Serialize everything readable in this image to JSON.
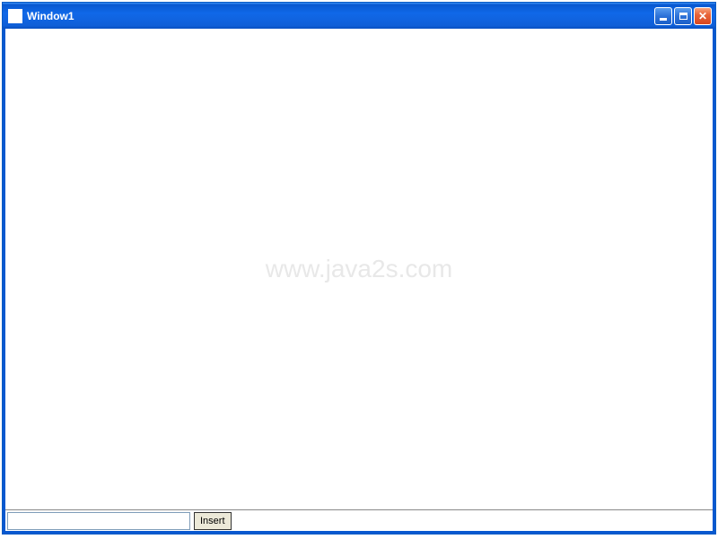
{
  "window": {
    "title": "Window1"
  },
  "watermark": "www.java2s.com",
  "bottom": {
    "input_value": "",
    "insert_label": "Insert"
  }
}
